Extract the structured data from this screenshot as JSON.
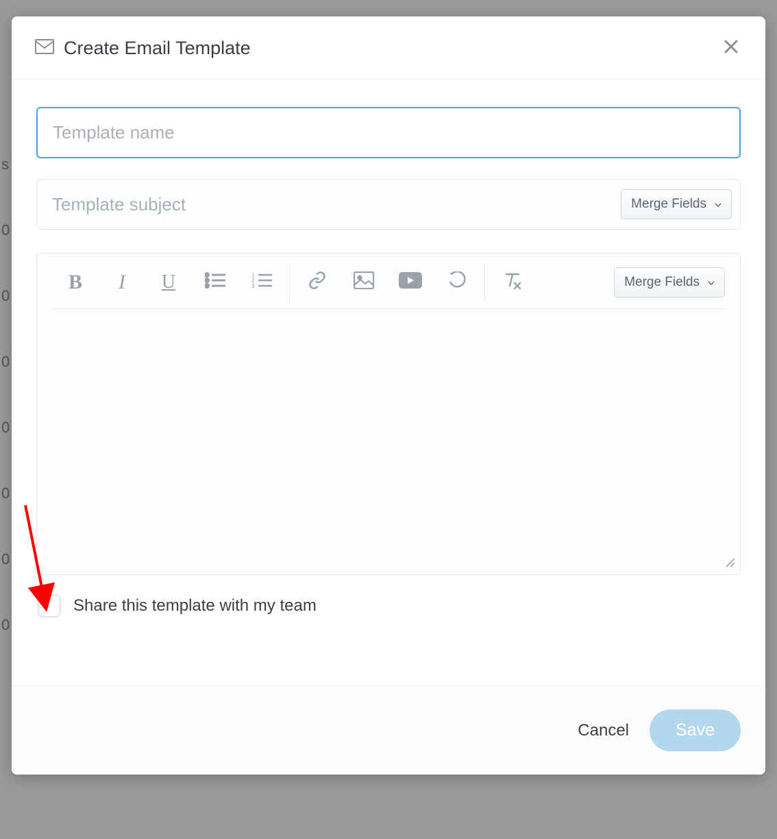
{
  "modal": {
    "title": "Create Email Template",
    "name_placeholder": "Template name",
    "subject_placeholder": "Template subject",
    "merge_fields_label": "Merge Fields",
    "share_label": "Share this template with my team",
    "cancel_label": "Cancel",
    "save_label": "Save"
  },
  "toolbar": {
    "bold": "bold-icon",
    "italic": "italic-icon",
    "underline": "underline-icon",
    "ul": "unordered-list-icon",
    "ol": "ordered-list-icon",
    "link": "link-icon",
    "image": "image-icon",
    "video": "video-icon",
    "undo": "undo-icon",
    "clear": "clear-format-icon"
  },
  "background_rows": [
    "s",
    "0",
    "0",
    "0",
    "0",
    "0",
    "0",
    "0"
  ]
}
